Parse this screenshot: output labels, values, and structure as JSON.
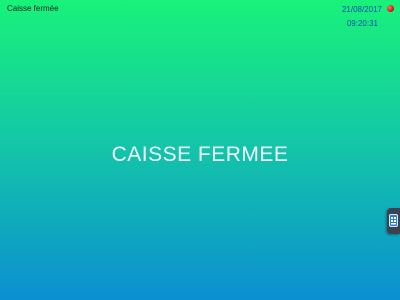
{
  "status_bar": {
    "title": "Caisse fermée",
    "date": "21/08/2017",
    "time": "09:20:31",
    "indicator_color": "#d11a1a"
  },
  "main": {
    "message": "CAISSE FERMEE"
  },
  "side_tab": {
    "icon": "keyboard-icon"
  },
  "colors": {
    "gradient_top": "#19f27a",
    "gradient_bottom": "#0b8fd1",
    "message_text": "#f2fbff",
    "status_blue": "#1550b0"
  }
}
